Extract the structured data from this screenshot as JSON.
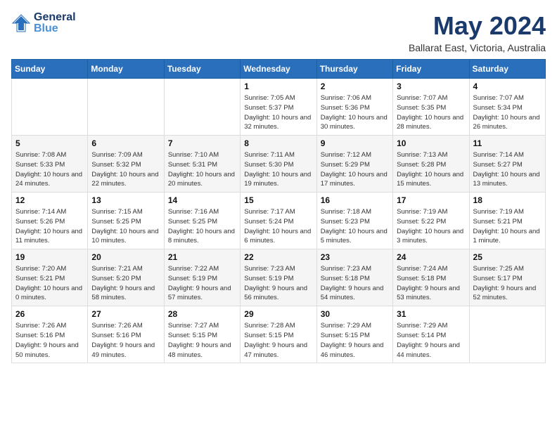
{
  "header": {
    "logo_line1": "General",
    "logo_line2": "Blue",
    "month_title": "May 2024",
    "location": "Ballarat East, Victoria, Australia"
  },
  "weekdays": [
    "Sunday",
    "Monday",
    "Tuesday",
    "Wednesday",
    "Thursday",
    "Friday",
    "Saturday"
  ],
  "weeks": [
    [
      {
        "day": "",
        "sunrise": "",
        "sunset": "",
        "daylight": ""
      },
      {
        "day": "",
        "sunrise": "",
        "sunset": "",
        "daylight": ""
      },
      {
        "day": "",
        "sunrise": "",
        "sunset": "",
        "daylight": ""
      },
      {
        "day": "1",
        "sunrise": "Sunrise: 7:05 AM",
        "sunset": "Sunset: 5:37 PM",
        "daylight": "Daylight: 10 hours and 32 minutes."
      },
      {
        "day": "2",
        "sunrise": "Sunrise: 7:06 AM",
        "sunset": "Sunset: 5:36 PM",
        "daylight": "Daylight: 10 hours and 30 minutes."
      },
      {
        "day": "3",
        "sunrise": "Sunrise: 7:07 AM",
        "sunset": "Sunset: 5:35 PM",
        "daylight": "Daylight: 10 hours and 28 minutes."
      },
      {
        "day": "4",
        "sunrise": "Sunrise: 7:07 AM",
        "sunset": "Sunset: 5:34 PM",
        "daylight": "Daylight: 10 hours and 26 minutes."
      }
    ],
    [
      {
        "day": "5",
        "sunrise": "Sunrise: 7:08 AM",
        "sunset": "Sunset: 5:33 PM",
        "daylight": "Daylight: 10 hours and 24 minutes."
      },
      {
        "day": "6",
        "sunrise": "Sunrise: 7:09 AM",
        "sunset": "Sunset: 5:32 PM",
        "daylight": "Daylight: 10 hours and 22 minutes."
      },
      {
        "day": "7",
        "sunrise": "Sunrise: 7:10 AM",
        "sunset": "Sunset: 5:31 PM",
        "daylight": "Daylight: 10 hours and 20 minutes."
      },
      {
        "day": "8",
        "sunrise": "Sunrise: 7:11 AM",
        "sunset": "Sunset: 5:30 PM",
        "daylight": "Daylight: 10 hours and 19 minutes."
      },
      {
        "day": "9",
        "sunrise": "Sunrise: 7:12 AM",
        "sunset": "Sunset: 5:29 PM",
        "daylight": "Daylight: 10 hours and 17 minutes."
      },
      {
        "day": "10",
        "sunrise": "Sunrise: 7:13 AM",
        "sunset": "Sunset: 5:28 PM",
        "daylight": "Daylight: 10 hours and 15 minutes."
      },
      {
        "day": "11",
        "sunrise": "Sunrise: 7:14 AM",
        "sunset": "Sunset: 5:27 PM",
        "daylight": "Daylight: 10 hours and 13 minutes."
      }
    ],
    [
      {
        "day": "12",
        "sunrise": "Sunrise: 7:14 AM",
        "sunset": "Sunset: 5:26 PM",
        "daylight": "Daylight: 10 hours and 11 minutes."
      },
      {
        "day": "13",
        "sunrise": "Sunrise: 7:15 AM",
        "sunset": "Sunset: 5:25 PM",
        "daylight": "Daylight: 10 hours and 10 minutes."
      },
      {
        "day": "14",
        "sunrise": "Sunrise: 7:16 AM",
        "sunset": "Sunset: 5:25 PM",
        "daylight": "Daylight: 10 hours and 8 minutes."
      },
      {
        "day": "15",
        "sunrise": "Sunrise: 7:17 AM",
        "sunset": "Sunset: 5:24 PM",
        "daylight": "Daylight: 10 hours and 6 minutes."
      },
      {
        "day": "16",
        "sunrise": "Sunrise: 7:18 AM",
        "sunset": "Sunset: 5:23 PM",
        "daylight": "Daylight: 10 hours and 5 minutes."
      },
      {
        "day": "17",
        "sunrise": "Sunrise: 7:19 AM",
        "sunset": "Sunset: 5:22 PM",
        "daylight": "Daylight: 10 hours and 3 minutes."
      },
      {
        "day": "18",
        "sunrise": "Sunrise: 7:19 AM",
        "sunset": "Sunset: 5:21 PM",
        "daylight": "Daylight: 10 hours and 1 minute."
      }
    ],
    [
      {
        "day": "19",
        "sunrise": "Sunrise: 7:20 AM",
        "sunset": "Sunset: 5:21 PM",
        "daylight": "Daylight: 10 hours and 0 minutes."
      },
      {
        "day": "20",
        "sunrise": "Sunrise: 7:21 AM",
        "sunset": "Sunset: 5:20 PM",
        "daylight": "Daylight: 9 hours and 58 minutes."
      },
      {
        "day": "21",
        "sunrise": "Sunrise: 7:22 AM",
        "sunset": "Sunset: 5:19 PM",
        "daylight": "Daylight: 9 hours and 57 minutes."
      },
      {
        "day": "22",
        "sunrise": "Sunrise: 7:23 AM",
        "sunset": "Sunset: 5:19 PM",
        "daylight": "Daylight: 9 hours and 56 minutes."
      },
      {
        "day": "23",
        "sunrise": "Sunrise: 7:23 AM",
        "sunset": "Sunset: 5:18 PM",
        "daylight": "Daylight: 9 hours and 54 minutes."
      },
      {
        "day": "24",
        "sunrise": "Sunrise: 7:24 AM",
        "sunset": "Sunset: 5:18 PM",
        "daylight": "Daylight: 9 hours and 53 minutes."
      },
      {
        "day": "25",
        "sunrise": "Sunrise: 7:25 AM",
        "sunset": "Sunset: 5:17 PM",
        "daylight": "Daylight: 9 hours and 52 minutes."
      }
    ],
    [
      {
        "day": "26",
        "sunrise": "Sunrise: 7:26 AM",
        "sunset": "Sunset: 5:16 PM",
        "daylight": "Daylight: 9 hours and 50 minutes."
      },
      {
        "day": "27",
        "sunrise": "Sunrise: 7:26 AM",
        "sunset": "Sunset: 5:16 PM",
        "daylight": "Daylight: 9 hours and 49 minutes."
      },
      {
        "day": "28",
        "sunrise": "Sunrise: 7:27 AM",
        "sunset": "Sunset: 5:15 PM",
        "daylight": "Daylight: 9 hours and 48 minutes."
      },
      {
        "day": "29",
        "sunrise": "Sunrise: 7:28 AM",
        "sunset": "Sunset: 5:15 PM",
        "daylight": "Daylight: 9 hours and 47 minutes."
      },
      {
        "day": "30",
        "sunrise": "Sunrise: 7:29 AM",
        "sunset": "Sunset: 5:15 PM",
        "daylight": "Daylight: 9 hours and 46 minutes."
      },
      {
        "day": "31",
        "sunrise": "Sunrise: 7:29 AM",
        "sunset": "Sunset: 5:14 PM",
        "daylight": "Daylight: 9 hours and 44 minutes."
      },
      {
        "day": "",
        "sunrise": "",
        "sunset": "",
        "daylight": ""
      }
    ]
  ]
}
